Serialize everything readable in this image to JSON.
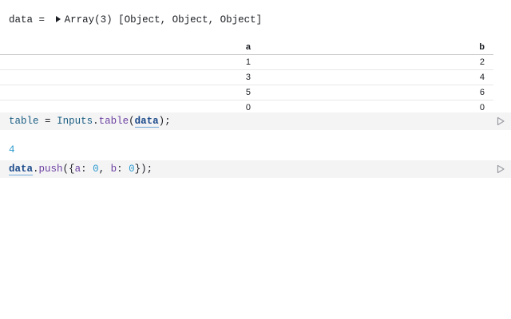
{
  "cells": {
    "data_output": {
      "name": "data",
      "equals": "=",
      "summary": "Array(3) [Object, Object, Object]"
    },
    "table": {
      "columns": [
        "a",
        "b"
      ],
      "rows": [
        [
          "1",
          "2"
        ],
        [
          "3",
          "4"
        ],
        [
          "5",
          "6"
        ],
        [
          "0",
          "0"
        ]
      ]
    },
    "table_code": {
      "var": "table",
      "equals": "=",
      "module": "Inputs",
      "dot": ".",
      "fn": "table",
      "open": "(",
      "arg": "data",
      "close": ");"
    },
    "number_output": "4",
    "push_code": {
      "ref": "data",
      "dot": ".",
      "fn": "push",
      "open": "({",
      "key_a": "a",
      "colon_a": ": ",
      "val_a": "0",
      "comma": ", ",
      "key_b": "b",
      "colon_b": ": ",
      "val_b": "0",
      "close": "});"
    }
  },
  "icons": {
    "expand": "caret-right-icon",
    "run": "run-play-icon"
  },
  "colors": {
    "code_background": "#f4f4f5",
    "number": "#2f9ccf",
    "function": "#6b3fa0",
    "definition": "#1b5e82"
  }
}
